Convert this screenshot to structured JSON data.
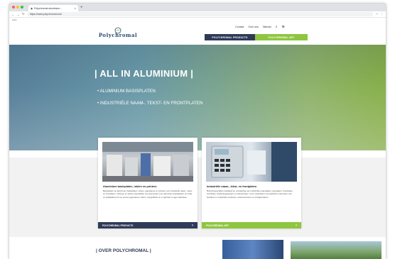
{
  "browser": {
    "tab_title": "Polychromal aluminium...",
    "url": "https://www.polychromal.com",
    "bookmark": "Labs"
  },
  "header": {
    "logo_text": "Polychromal",
    "links": [
      "Contact",
      "Over ons",
      "Nieuws"
    ],
    "cta_products": "POLYCHROMAL PRODUCTS",
    "cta_frontplaten": "POLYCHROMAL ART"
  },
  "hero": {
    "title": "| ALL IN ALUMINIUM |",
    "items": [
      "• ALUMINIUM BASISPLATEN",
      "• INDUSTRIËLE NAAM-, TEKST- EN FRONTPLATEN"
    ]
  },
  "cards": [
    {
      "title": "Aluminium basisplaten, inkten en printers",
      "text": "Basisplaten op aluminium basisplaten, inkten, apparatuur en printers voor industriële naam-, tekst- en frontplaten. Verkoop en advies wereldwijd. Uw leverancier voor aluminium basisplaten op maat en kwalitatief print en proces apparatuur, inkten, fotografisch en in gebruik in eigen fabrieken.",
      "footer": "POLYCHROMAL PRODUCTS"
    },
    {
      "title": "Industriële naam-, tekst- en frontplaten",
      "text": "Branchespecialist ontwikkelt en vervaardigt van industriële naamplaten, typeplaten, frontplaten, frontfolies, bedieningspanelen en behuizingen. Voor onderdelen met grafische instructies voor bedrijven in industriële productie, toeleveranciers en eindgebruikers.",
      "footer": "POLYCHROMAL ART"
    }
  ],
  "about": {
    "title": "| OVER POLYCHROMAL |"
  },
  "colors": {
    "navy": "#2e3a58",
    "green": "#8ec63f"
  }
}
